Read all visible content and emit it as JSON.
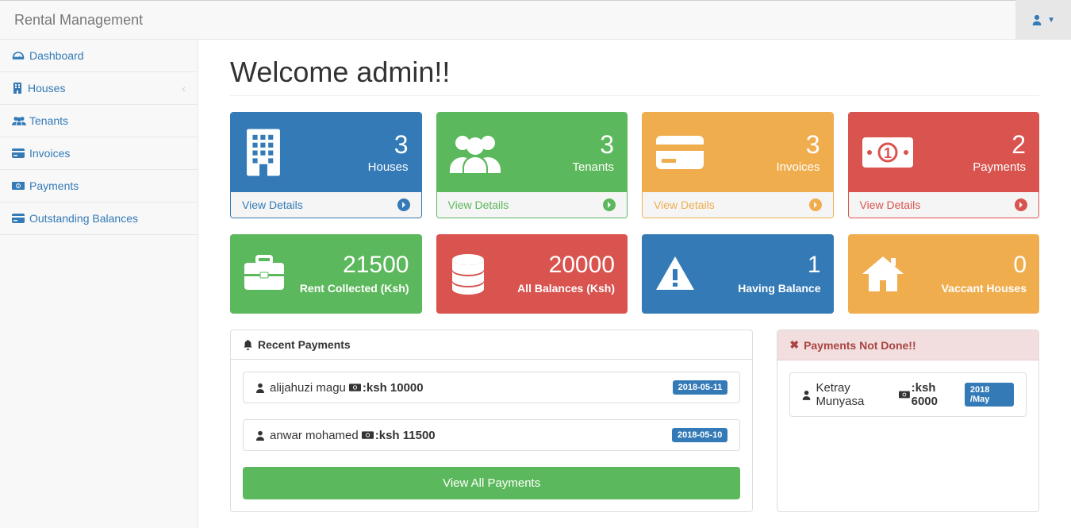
{
  "brand": "Rental Management",
  "nav": {
    "dashboard": "Dashboard",
    "houses": "Houses",
    "tenants": "Tenants",
    "invoices": "Invoices",
    "payments": "Payments",
    "balances": "Outstanding Balances"
  },
  "page_title": "Welcome admin!!",
  "cards1": {
    "houses": {
      "num": "3",
      "label": "Houses",
      "link": "View Details"
    },
    "tenants": {
      "num": "3",
      "label": "Tenants",
      "link": "View Details"
    },
    "invoices": {
      "num": "3",
      "label": "Invoices",
      "link": "View Details"
    },
    "payments": {
      "num": "2",
      "label": "Payments",
      "link": "View Details"
    }
  },
  "cards2": {
    "rent": {
      "num": "21500",
      "label": "Rent Collected (Ksh)"
    },
    "bal": {
      "num": "20000",
      "label": "All Balances (Ksh)"
    },
    "havebal": {
      "num": "1",
      "label": "Having Balance"
    },
    "vacant": {
      "num": "0",
      "label": "Vaccant Houses"
    }
  },
  "recent": {
    "title": "Recent Payments",
    "items": [
      {
        "name": "alijahuzi magu",
        "amount": ":ksh 10000",
        "date": "2018-05-11"
      },
      {
        "name": "anwar mohamed",
        "amount": ":ksh 11500",
        "date": "2018-05-10"
      }
    ],
    "button": "View All Payments"
  },
  "notdone": {
    "title": "Payments Not Done!!",
    "items": [
      {
        "name": "Ketray Munyasa",
        "amount": ":ksh 6000",
        "period": "2018 /May"
      }
    ]
  }
}
